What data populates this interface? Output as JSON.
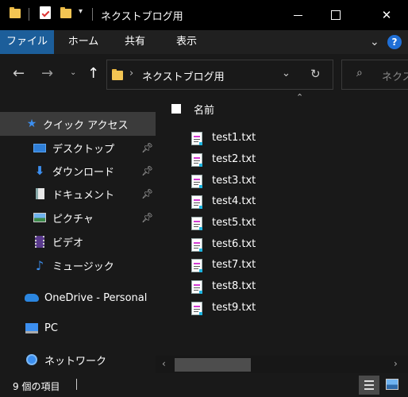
{
  "window": {
    "title": "ネクストブログ用"
  },
  "ribbon": {
    "tabs": [
      "ファイル",
      "ホーム",
      "共有",
      "表示"
    ]
  },
  "address": {
    "path": "ネクストブログ用",
    "search_placeholder": "ネクス"
  },
  "columns": {
    "name": "名前"
  },
  "sidebar": {
    "items": [
      {
        "label": "クイック アクセス",
        "icon": "star-icon",
        "selected": true,
        "pinned": false
      },
      {
        "label": "デスクトップ",
        "icon": "desktop-icon",
        "selected": false,
        "pinned": true
      },
      {
        "label": "ダウンロード",
        "icon": "download-arrow-icon",
        "selected": false,
        "pinned": true
      },
      {
        "label": "ドキュメント",
        "icon": "document-icon",
        "selected": false,
        "pinned": true
      },
      {
        "label": "ピクチャ",
        "icon": "pictures-icon",
        "selected": false,
        "pinned": true
      },
      {
        "label": "ビデオ",
        "icon": "video-icon",
        "selected": false,
        "pinned": false
      },
      {
        "label": "ミュージック",
        "icon": "music-note-icon",
        "selected": false,
        "pinned": false
      },
      {
        "label": "OneDrive - Personal",
        "icon": "cloud-icon",
        "selected": false,
        "pinned": false
      },
      {
        "label": "PC",
        "icon": "pc-icon",
        "selected": false,
        "pinned": false
      },
      {
        "label": "ネットワーク",
        "icon": "network-icon",
        "selected": false,
        "pinned": false
      }
    ]
  },
  "files": [
    {
      "name": "test1.txt"
    },
    {
      "name": "test2.txt"
    },
    {
      "name": "test3.txt"
    },
    {
      "name": "test4.txt"
    },
    {
      "name": "test5.txt"
    },
    {
      "name": "test6.txt"
    },
    {
      "name": "test7.txt"
    },
    {
      "name": "test8.txt"
    },
    {
      "name": "test9.txt"
    }
  ],
  "status": {
    "item_count": "9 個の項目"
  },
  "colors": {
    "accent": "#1c5e9a",
    "help": "#1f6fd6",
    "background": "#191919",
    "selected": "#3b3b3b"
  }
}
